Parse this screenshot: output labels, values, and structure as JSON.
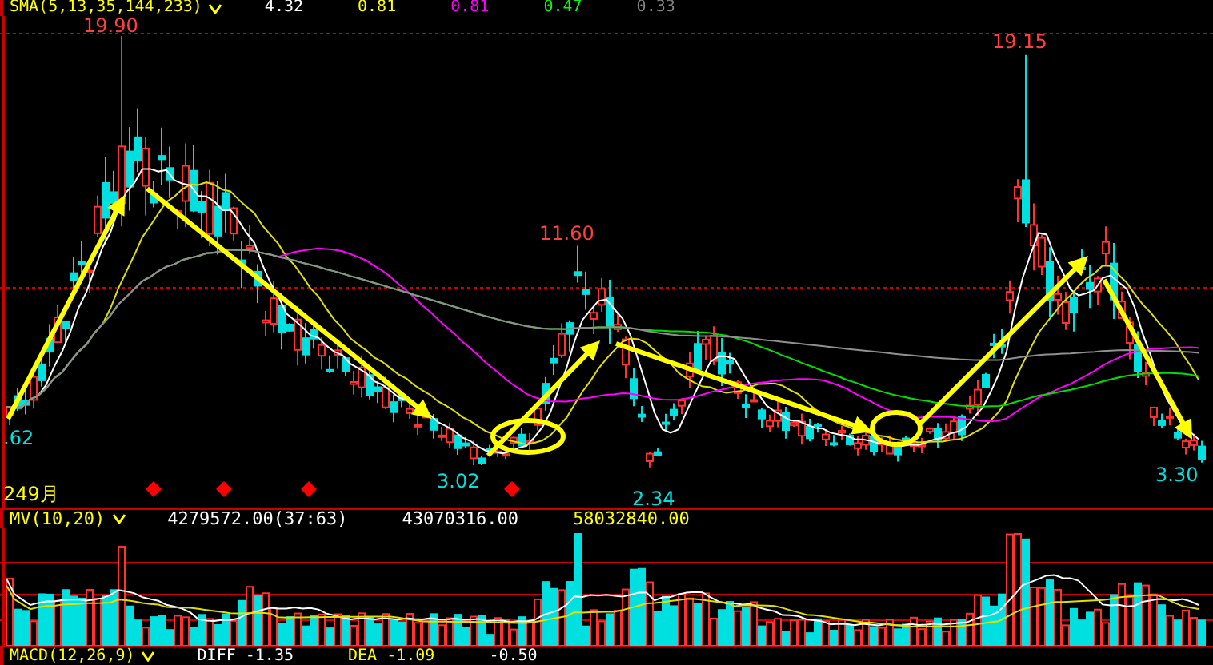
{
  "indicator_bar": {
    "name": "SMA(5,13,35,144,233)",
    "values": [
      {
        "text": "4.32",
        "color": "#ffffff"
      },
      {
        "text": "0.81",
        "color": "#ffff00"
      },
      {
        "text": "0.81",
        "color": "#ff00ff"
      },
      {
        "text": "0.47",
        "color": "#00ff00"
      },
      {
        "text": "0.33",
        "color": "#808080"
      }
    ]
  },
  "price_chart": {
    "high_labels": [
      "19.90",
      "19.15",
      "11.60"
    ],
    "low_labels": [
      "3.02",
      "2.34",
      "3.30"
    ],
    "edge_label": ".62",
    "date_label": "249月"
  },
  "volume_panel": {
    "name": "MV(10,20)",
    "values": [
      {
        "text": "4279572.00(37:63)",
        "color": "#ffffff"
      },
      {
        "text": "43070316.00",
        "color": "#ffffff"
      },
      {
        "text": "58032840.00",
        "color": "#ffff00"
      }
    ]
  },
  "macd_panel": {
    "name": "MACD(12,26,9)",
    "values": [
      {
        "text": "DIFF -1.35",
        "color": "#ffffff"
      },
      {
        "text": "DEA -1.09",
        "color": "#ffff00"
      },
      {
        "text": "-0.50",
        "color": "#ffffff"
      }
    ]
  }
}
